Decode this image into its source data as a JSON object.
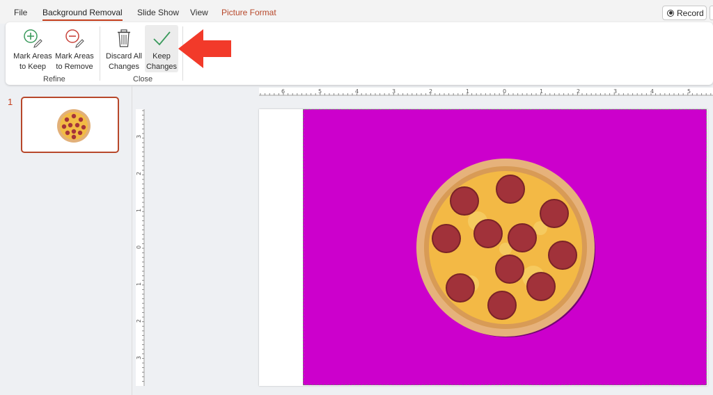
{
  "menubar": {
    "tabs": [
      {
        "label": "File"
      },
      {
        "label": "Background Removal"
      },
      {
        "label": "Slide Show"
      },
      {
        "label": "View"
      },
      {
        "label": "Picture Format"
      }
    ],
    "record_label": "Record"
  },
  "ribbon": {
    "refine": {
      "group_label": "Refine",
      "keep_line1": "Mark Areas",
      "keep_line2": "to Keep",
      "remove_line1": "Mark Areas",
      "remove_line2": "to Remove"
    },
    "close": {
      "group_label": "Close",
      "discard_line1": "Discard All",
      "discard_line2": "Changes",
      "keepchanges_line1": "Keep",
      "keepchanges_line2": "Changes"
    }
  },
  "slides_panel": {
    "slide_number": "1"
  },
  "rulers": {
    "horizontal": [
      "6",
      "5",
      "4",
      "3",
      "2",
      "1",
      "0",
      "1",
      "2",
      "3",
      "4",
      "5"
    ],
    "vertical": [
      "3",
      "2",
      "1",
      "0",
      "1",
      "2",
      "3"
    ]
  },
  "colors": {
    "accent": "#c43e1c",
    "picture_background": "#cc00cc",
    "arrow": "#f23a2a"
  },
  "icons": {
    "mark_keep": "pencil-plus-icon",
    "mark_remove": "pencil-minus-icon",
    "discard": "trash-icon",
    "keep_changes": "checkmark-icon"
  }
}
